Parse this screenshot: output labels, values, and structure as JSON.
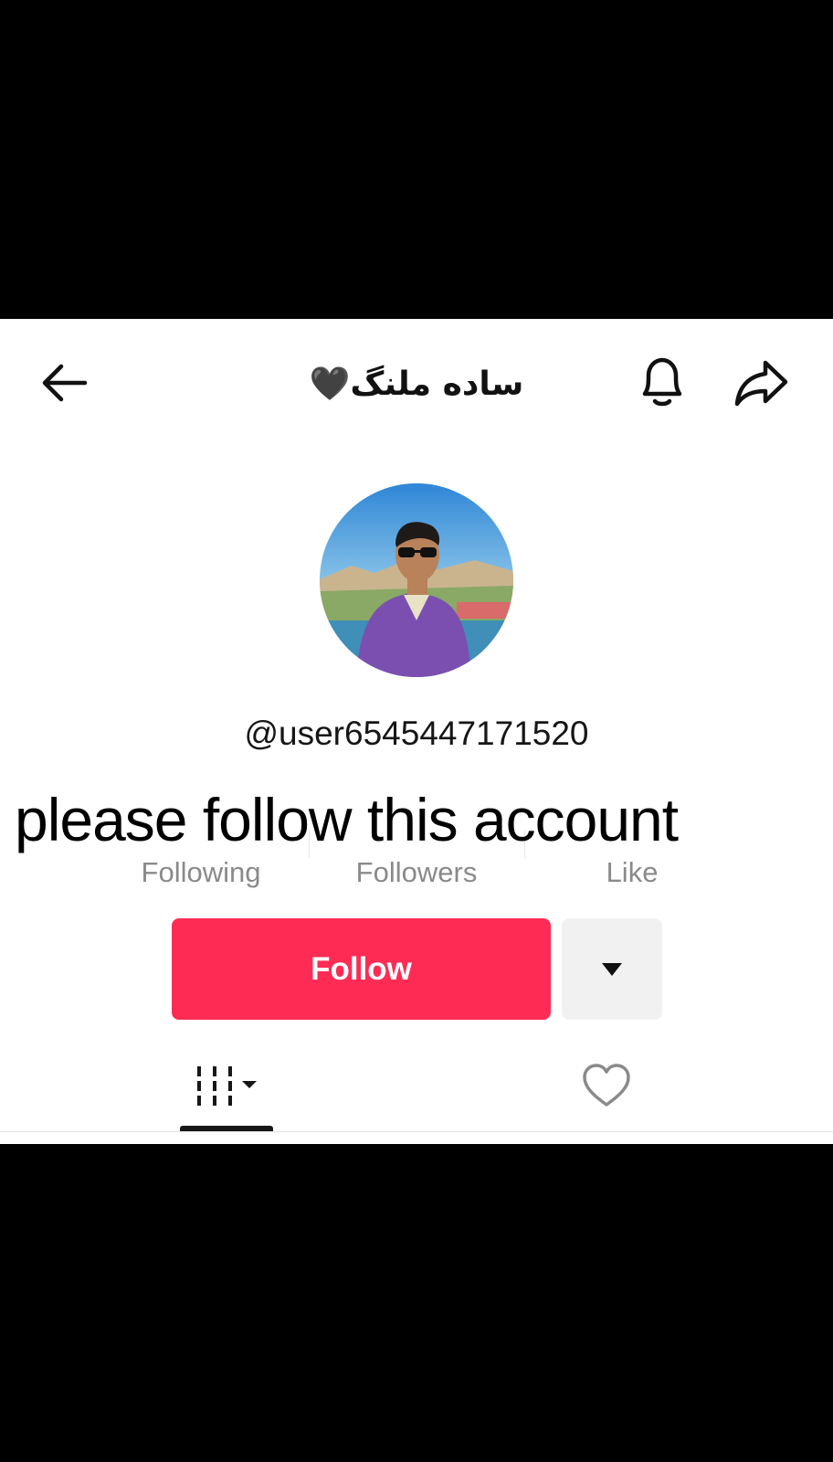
{
  "header": {
    "profile_name": "ساده ملنگ🖤",
    "icons": {
      "back": "back-arrow-icon",
      "bell": "bell-icon",
      "share": "share-icon"
    }
  },
  "profile": {
    "username": "@user6545447171520"
  },
  "overlay": {
    "caption": "please follow this account"
  },
  "stats": {
    "following_label": "Following",
    "followers_label": "Followers",
    "like_label": "Like"
  },
  "actions": {
    "follow_label": "Follow",
    "more_icon": "caret-down-icon"
  },
  "tabs": {
    "videos_icon": "video-grid-icon",
    "liked_icon": "heart-outline-icon"
  },
  "colors": {
    "follow_button": "#fe2c55",
    "dropdown_button": "#f1f1f2",
    "stat_label": "#8a8a8a"
  }
}
